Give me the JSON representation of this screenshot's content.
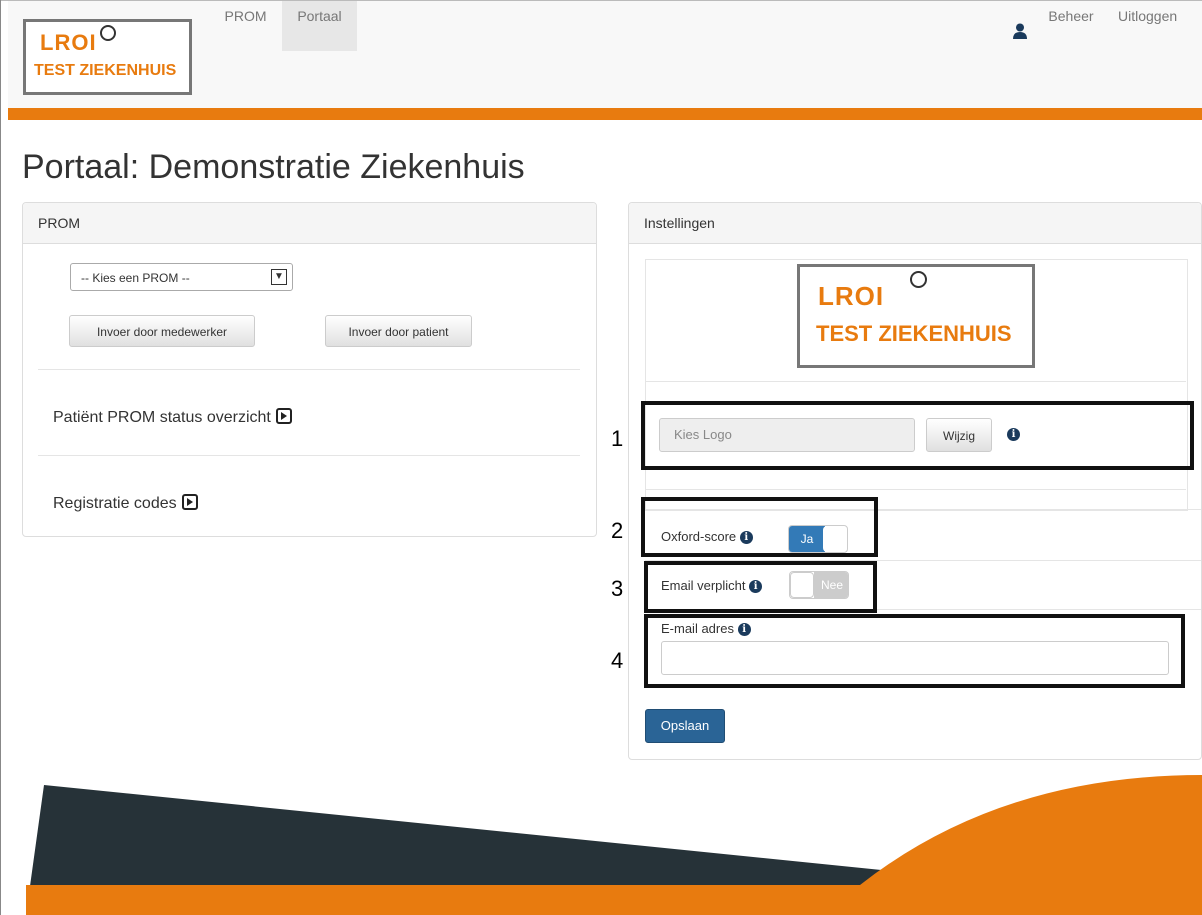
{
  "navbar": {
    "logo_title": "LROI",
    "logo_subtitle": "TEST ZIEKENHUIS",
    "links": [
      "PROM",
      "Portaal"
    ],
    "active": "Portaal",
    "beheer": "Beheer",
    "uitloggen": "Uitloggen",
    "accent_color": "#e87b0f"
  },
  "page": {
    "title": "Portaal: Demonstratie Ziekenhuis"
  },
  "prom_panel": {
    "heading": "PROM",
    "select_value": "-- Kies een PROM --",
    "btn_medewerker": "Invoer door medewerker",
    "btn_patient": "Invoer door patient",
    "link_status": "Patiënt PROM status overzicht",
    "link_codes": "Registratie codes"
  },
  "settings_panel": {
    "heading": "Instellingen",
    "logo_title": "LROI",
    "logo_subtitle": "TEST ZIEKENHUIS",
    "logo_placeholder": "Kies Logo",
    "btn_wijzig": "Wijzig",
    "oxford_label": "Oxford-score",
    "oxford_toggle": "Ja",
    "email_required_label": "Email verplicht",
    "email_required_toggle": "Nee",
    "email_label": "E-mail adres",
    "email_value": "",
    "btn_save": "Opslaan"
  },
  "callouts": [
    "1",
    "2",
    "3",
    "4"
  ]
}
